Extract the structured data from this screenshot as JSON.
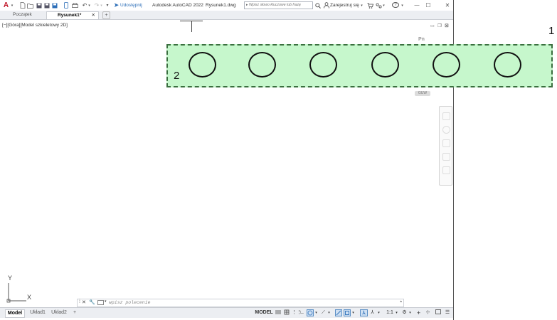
{
  "titlebar": {
    "app_menu": "A",
    "share_label": "Udostępnij",
    "app_title": "Autodesk AutoCAD 2022",
    "file_name": "Rysunek1.dwg",
    "search_placeholder": "Wpisz słowo kluczowe lub frazę",
    "signin_label": "Zarejestruj się",
    "help_label": "?",
    "minimize": "—",
    "maximize": "☐",
    "close": "✕"
  },
  "tabs": {
    "start": "Początek",
    "drawing": "Rysunek1*",
    "close": "✕",
    "add": "+"
  },
  "viewport": {
    "label": "[−][Góra][Model szkieletowy 2D]",
    "viewcube_label": "Pn",
    "wcs_label": "GUW"
  },
  "selection": {
    "circle_count": 6
  },
  "annotations": {
    "one": "1",
    "two": "2"
  },
  "ucs": {
    "x": "X",
    "y": "Y"
  },
  "command": {
    "placeholder": "wpisz polecenie"
  },
  "layout_tabs": {
    "model": "Model",
    "layout1": "Układ1",
    "layout2": "Układ2",
    "add": "+"
  },
  "status": {
    "model": "MODEL",
    "scale": "1:1"
  }
}
